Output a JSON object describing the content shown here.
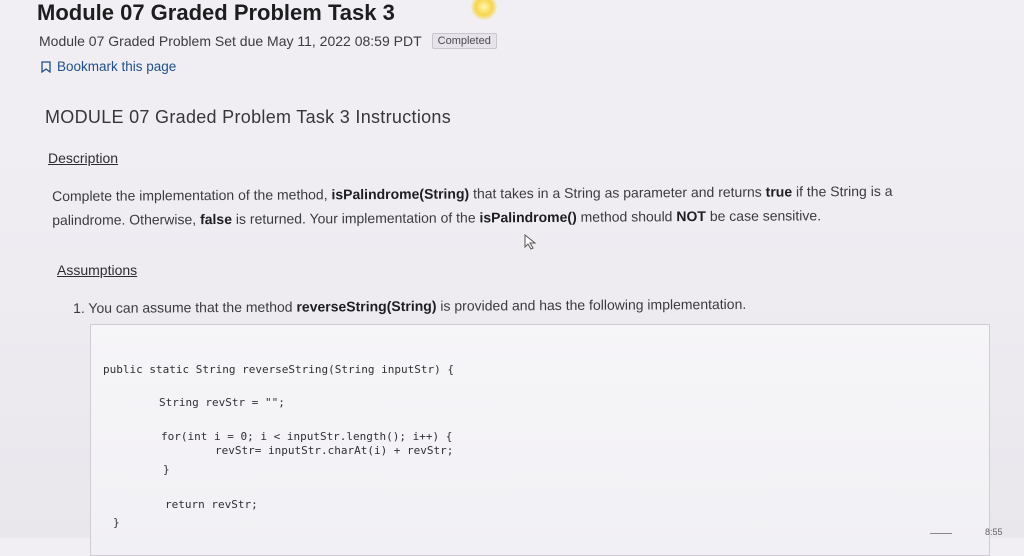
{
  "header": {
    "title": "Module 07 Graded Problem Task 3",
    "subtitle": "Module 07 Graded Problem Set due May 11, 2022 08:59 PDT",
    "status": "Completed",
    "bookmark_label": "Bookmark this page"
  },
  "content": {
    "heading": "MODULE 07 Graded Problem Task 3 Instructions",
    "description_link": "Description",
    "description": {
      "p1": "Complete the implementation of the method, ",
      "b1": "isPalindrome(String)",
      "p2": " that takes in a String as parameter and returns ",
      "b2": "true",
      "p3": " if the String is a palindrome. Otherwise, ",
      "b3": "false",
      "p4": " is returned. Your implementation of the ",
      "b4": "isPalindrome()",
      "p5": " method should ",
      "b5": "NOT",
      "p6": " be case sensitive."
    },
    "assumptions_link": "Assumptions",
    "assumption_1": {
      "p1": "1. You can assume that the method ",
      "b1": "reverseString(String)",
      "p2": " is provided and has the following implementation."
    },
    "code": [
      "public static String reverseString(String inputStr) {",
      "String revStr = \"\";",
      "for(int i = 0; i < inputStr.length(); i++) {",
      "revStr= inputStr.charAt(i) + revStr;",
      "}",
      "return revStr;",
      "}"
    ]
  },
  "taskbar": {
    "time": "8:55"
  }
}
